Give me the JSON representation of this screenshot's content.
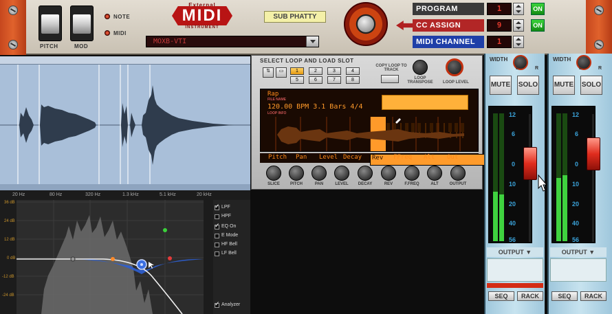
{
  "midi_device": {
    "logo_top": "External",
    "logo_main": "MIDI",
    "logo_bottom": "INSTRUMENT",
    "pitch_label": "PITCH",
    "mod_label": "MOD",
    "note_label": "NOTE",
    "midi_label": "MIDI",
    "device_name": "SUB PHATTY",
    "patch_select_value": "MOXB-VTI",
    "program_label": "PROGRAM",
    "program_value": "1",
    "program_on": "ON",
    "cc_assign_label": "CC ASSIGN",
    "cc_assign_value": "9",
    "cc_on": "ON",
    "midi_channel_label": "MIDI CHANNEL",
    "midi_channel_value": "1",
    "colors": {
      "program": "#3a3a3a",
      "cc_assign": "#b22626",
      "midi_channel": "#1f3fa8"
    }
  },
  "eq": {
    "freq_labels": [
      "20 Hz",
      "80 Hz",
      "320 Hz",
      "1.3 kHz",
      "5.1 kHz",
      "20 kHz"
    ],
    "db_labels": [
      "36 dB",
      "24 dB",
      "12 dB",
      "0 dB",
      "-12 dB",
      "-24 dB",
      "-36 dB"
    ],
    "options": [
      {
        "label": "LPF",
        "checked": true
      },
      {
        "label": "HPF",
        "checked": false
      },
      {
        "label": "EQ On",
        "checked": true
      },
      {
        "label": "E Mode",
        "checked": false
      },
      {
        "label": "HF Bell",
        "checked": false
      },
      {
        "label": "LF Bell",
        "checked": false
      }
    ],
    "analyzer_label": "Analyzer",
    "analyzer_checked": true
  },
  "loop_player": {
    "title": "SELECT LOOP AND LOAD SLOT",
    "slots": [
      "1",
      "2",
      "3",
      "4",
      "5",
      "6",
      "7",
      "8"
    ],
    "active_slot": "1",
    "copy_loop_label": "COPY LOOP TO TRACK",
    "loop_transpose_label": "LOOP TRANSPOSE",
    "loop_level_label": "LOOP LEVEL",
    "file_name": "Rap",
    "file_name_caption": "FILE NAME",
    "loop_info": "120.00 BPM  3.1 Bars 4/4",
    "loop_info_caption": "LOOP INFO",
    "params": [
      "Pitch",
      "Pan",
      "Level",
      "Decay",
      "Rev",
      "FFreq",
      "Alt",
      "Out"
    ],
    "selected_param": "Rev",
    "knobs": [
      "SLICE",
      "PITCH",
      "PAN",
      "LEVEL",
      "DECAY",
      "REV",
      "F.FREQ",
      "ALT",
      "OUTPUT"
    ]
  },
  "mixer": {
    "channels": [
      {
        "width_label": "WIDTH",
        "l": "L",
        "r": "R",
        "mute": "MUTE",
        "solo": "SOLO",
        "output": "OUTPUT",
        "seq": "SEQ",
        "rack": "RACK"
      },
      {
        "width_label": "WIDTH",
        "l": "L",
        "r": "R",
        "mute": "MUTE",
        "solo": "SOLO",
        "output": "OUTPUT",
        "seq": "SEQ",
        "rack": "RACK"
      }
    ],
    "meter_scale": [
      "12",
      "6",
      "0",
      "10",
      "20",
      "40",
      "56"
    ]
  }
}
